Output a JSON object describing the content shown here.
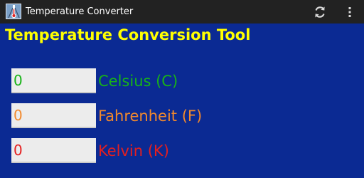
{
  "action_bar": {
    "title": "Temperature Converter",
    "icons": {
      "app": "app-thermometer-icon",
      "refresh": "refresh-icon",
      "overflow": "overflow-menu-icon"
    }
  },
  "main": {
    "heading": "Temperature Conversion Tool",
    "rows": [
      {
        "value": "0",
        "label": "Celsius (C)",
        "color": "#17b317"
      },
      {
        "value": "0",
        "label": "Fahrenheit (F)",
        "color": "#f2892c"
      },
      {
        "value": "0",
        "label": "Kelvin (K)",
        "color": "#e51f1f"
      }
    ]
  },
  "colors": {
    "background": "#0b2a93",
    "action_bar": "#222222",
    "heading": "#ffff00",
    "field_background": "#ececec"
  }
}
